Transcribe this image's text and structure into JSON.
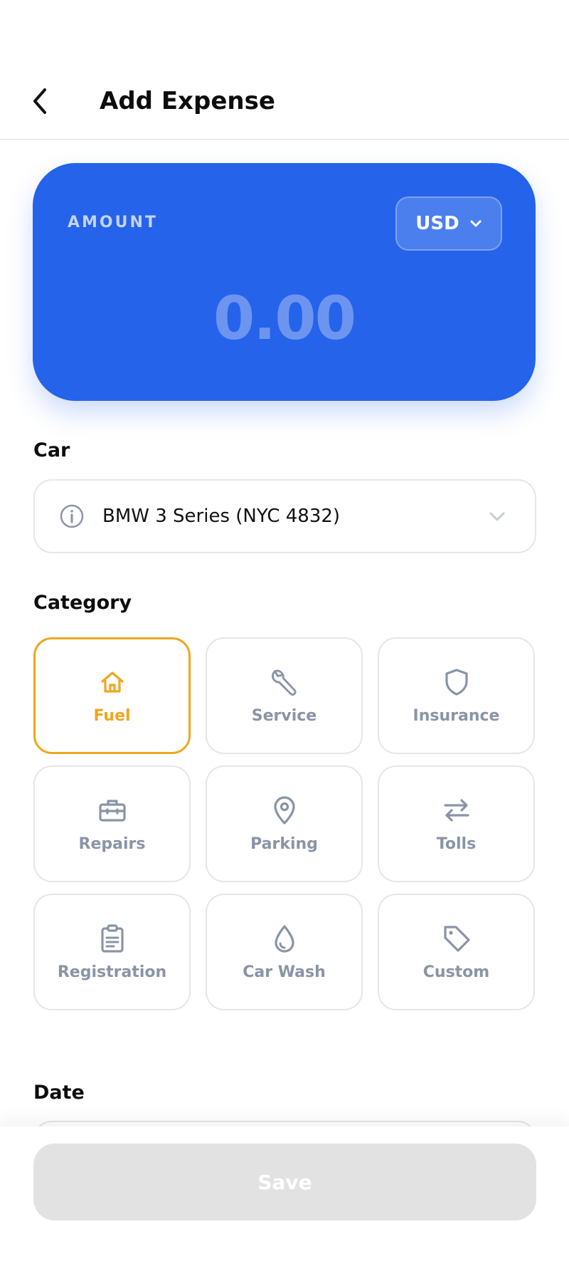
{
  "header": {
    "title": "Add Expense"
  },
  "amount_card": {
    "label": "AMOUNT",
    "currency": "USD",
    "value": "0.00"
  },
  "car": {
    "label": "Car",
    "selected": "BMW 3 Series (NYC 4832)"
  },
  "category": {
    "label": "Category",
    "selected_color": "#f0a61f",
    "items": [
      {
        "label": "Fuel",
        "icon": "home-icon",
        "selected": true
      },
      {
        "label": "Service",
        "icon": "wrench-icon",
        "selected": false
      },
      {
        "label": "Insurance",
        "icon": "shield-icon",
        "selected": false
      },
      {
        "label": "Repairs",
        "icon": "toolbox-icon",
        "selected": false
      },
      {
        "label": "Parking",
        "icon": "map-pin-icon",
        "selected": false
      },
      {
        "label": "Tolls",
        "icon": "swap-arrows-icon",
        "selected": false
      },
      {
        "label": "Registration",
        "icon": "clipboard-icon",
        "selected": false
      },
      {
        "label": "Car Wash",
        "icon": "droplet-icon",
        "selected": false
      },
      {
        "label": "Custom",
        "icon": "tag-icon",
        "selected": false
      }
    ]
  },
  "date": {
    "label": "Date"
  },
  "footer": {
    "save_label": "Save"
  },
  "colors": {
    "accent_blue": "#2563eb",
    "selected_orange": "#f0a61f",
    "muted_gray": "#8a94a6",
    "disabled_button": "#e2e2e2"
  }
}
